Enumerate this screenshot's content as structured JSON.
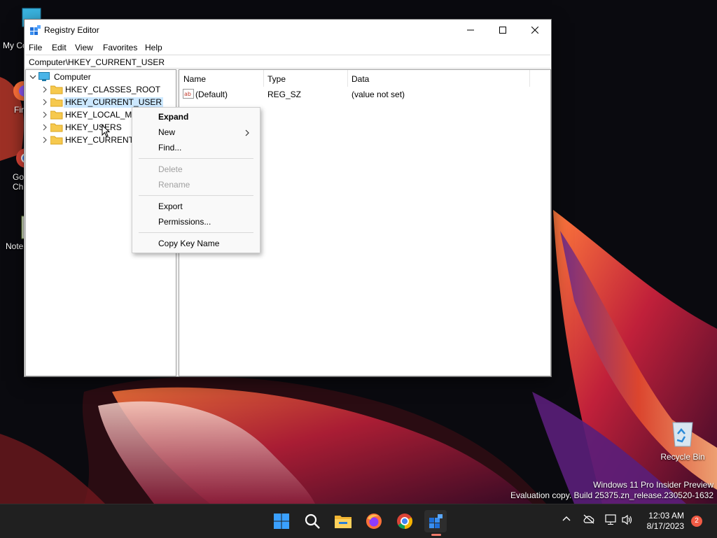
{
  "desktop": {
    "icons": [
      {
        "label": "My Computer"
      },
      {
        "label": "Firefox"
      },
      {
        "label": "Google Chrome"
      },
      {
        "label": "Notepad++"
      },
      {
        "label": "Recycle Bin"
      }
    ],
    "watermark": {
      "line1": "Windows 11 Pro Insider Preview",
      "line2": "Evaluation copy. Build 25375.zn_release.230520-1632"
    }
  },
  "window": {
    "title": "Registry Editor",
    "menu": [
      "File",
      "Edit",
      "View",
      "Favorites",
      "Help"
    ],
    "address": "Computer\\HKEY_CURRENT_USER",
    "tree": {
      "root": "Computer",
      "items": [
        {
          "label": "HKEY_CLASSES_ROOT"
        },
        {
          "label": "HKEY_CURRENT_USER",
          "selected": true
        },
        {
          "label": "HKEY_LOCAL_MACHINE"
        },
        {
          "label": "HKEY_USERS"
        },
        {
          "label": "HKEY_CURRENT_CONFIG"
        }
      ]
    },
    "list": {
      "columns": [
        "Name",
        "Type",
        "Data"
      ],
      "rows": [
        {
          "name": "(Default)",
          "type": "REG_SZ",
          "data": "(value not set)"
        }
      ]
    }
  },
  "context_menu": {
    "expand": "Expand",
    "new": "New",
    "find": "Find...",
    "delete": "Delete",
    "rename": "Rename",
    "export": "Export",
    "permissions": "Permissions...",
    "copy_key_name": "Copy Key Name"
  },
  "taskbar": {
    "time": "12:03 AM",
    "date": "8/17/2023",
    "notifications": "2"
  },
  "colors": {
    "selection": "#cce8ff",
    "taskbar": "#202020",
    "accent": "#0078d4"
  }
}
